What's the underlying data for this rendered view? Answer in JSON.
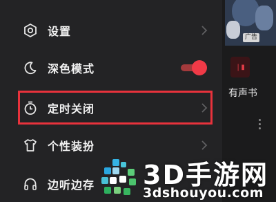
{
  "drawer": {
    "items": [
      {
        "label": "设置",
        "icon": "settings-icon"
      },
      {
        "label": "深色模式",
        "icon": "moon-icon",
        "toggle_on": true
      },
      {
        "label": "定时关闭",
        "icon": "timer-icon",
        "highlighted": true
      },
      {
        "label": "个性装扮",
        "icon": "tshirt-icon"
      },
      {
        "label": "边听边存",
        "icon": "headphones-icon"
      }
    ]
  },
  "right_pane": {
    "ad_badge": "广告",
    "book_label": "有声书"
  },
  "watermark": {
    "brand": "3D手游网",
    "domain": "3dshouyou.com"
  },
  "colors": {
    "accent": "#f03a47",
    "highlight_border": "#e8323c",
    "drawer_bg": "#232325"
  }
}
